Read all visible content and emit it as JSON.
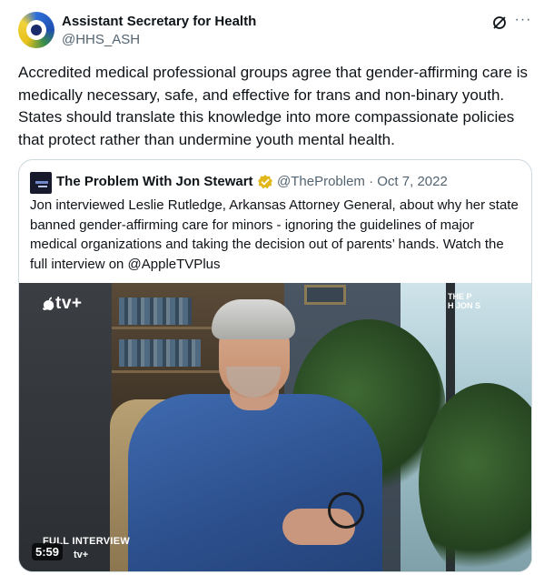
{
  "author": {
    "name": "Assistant Secretary for Health",
    "handle": "@HHS_ASH",
    "avatar_icon": "hhs-ash-logo"
  },
  "header_actions": {
    "grok_icon": "grok-icon",
    "more_label": "···"
  },
  "tweet": {
    "text": "Accredited medical professional groups agree that gender-affirming care is medically necessary, safe, and effective for trans and non-binary youth. States should translate this knowledge into more compassionate policies that protect rather than undermine youth mental health."
  },
  "quote": {
    "name": "The Problem With Jon Stewart",
    "verified_icon": "gold-verified-badge-icon",
    "handle_date": "@TheProblem · Oct 7, 2022",
    "text": "Jon interviewed Leslie Rutledge, Arkansas Attorney General, about why her state banned gender-affirming care for minors - ignoring the guidelines of major medical organizations and taking the decision out of parents’ hands. Watch the full interview on @AppleTVPlus",
    "video": {
      "logo_text": "tv+",
      "corner_text_line1": "THE P",
      "corner_text_line2": "H JON S",
      "overlay_label": "FULL INTERVIEW",
      "duration": "5:59",
      "duration_suffix": "tv+"
    }
  },
  "colors": {
    "text": "#0f1419",
    "muted": "#536471",
    "border": "#cfd9de",
    "verified_gold": "#e2b719"
  }
}
